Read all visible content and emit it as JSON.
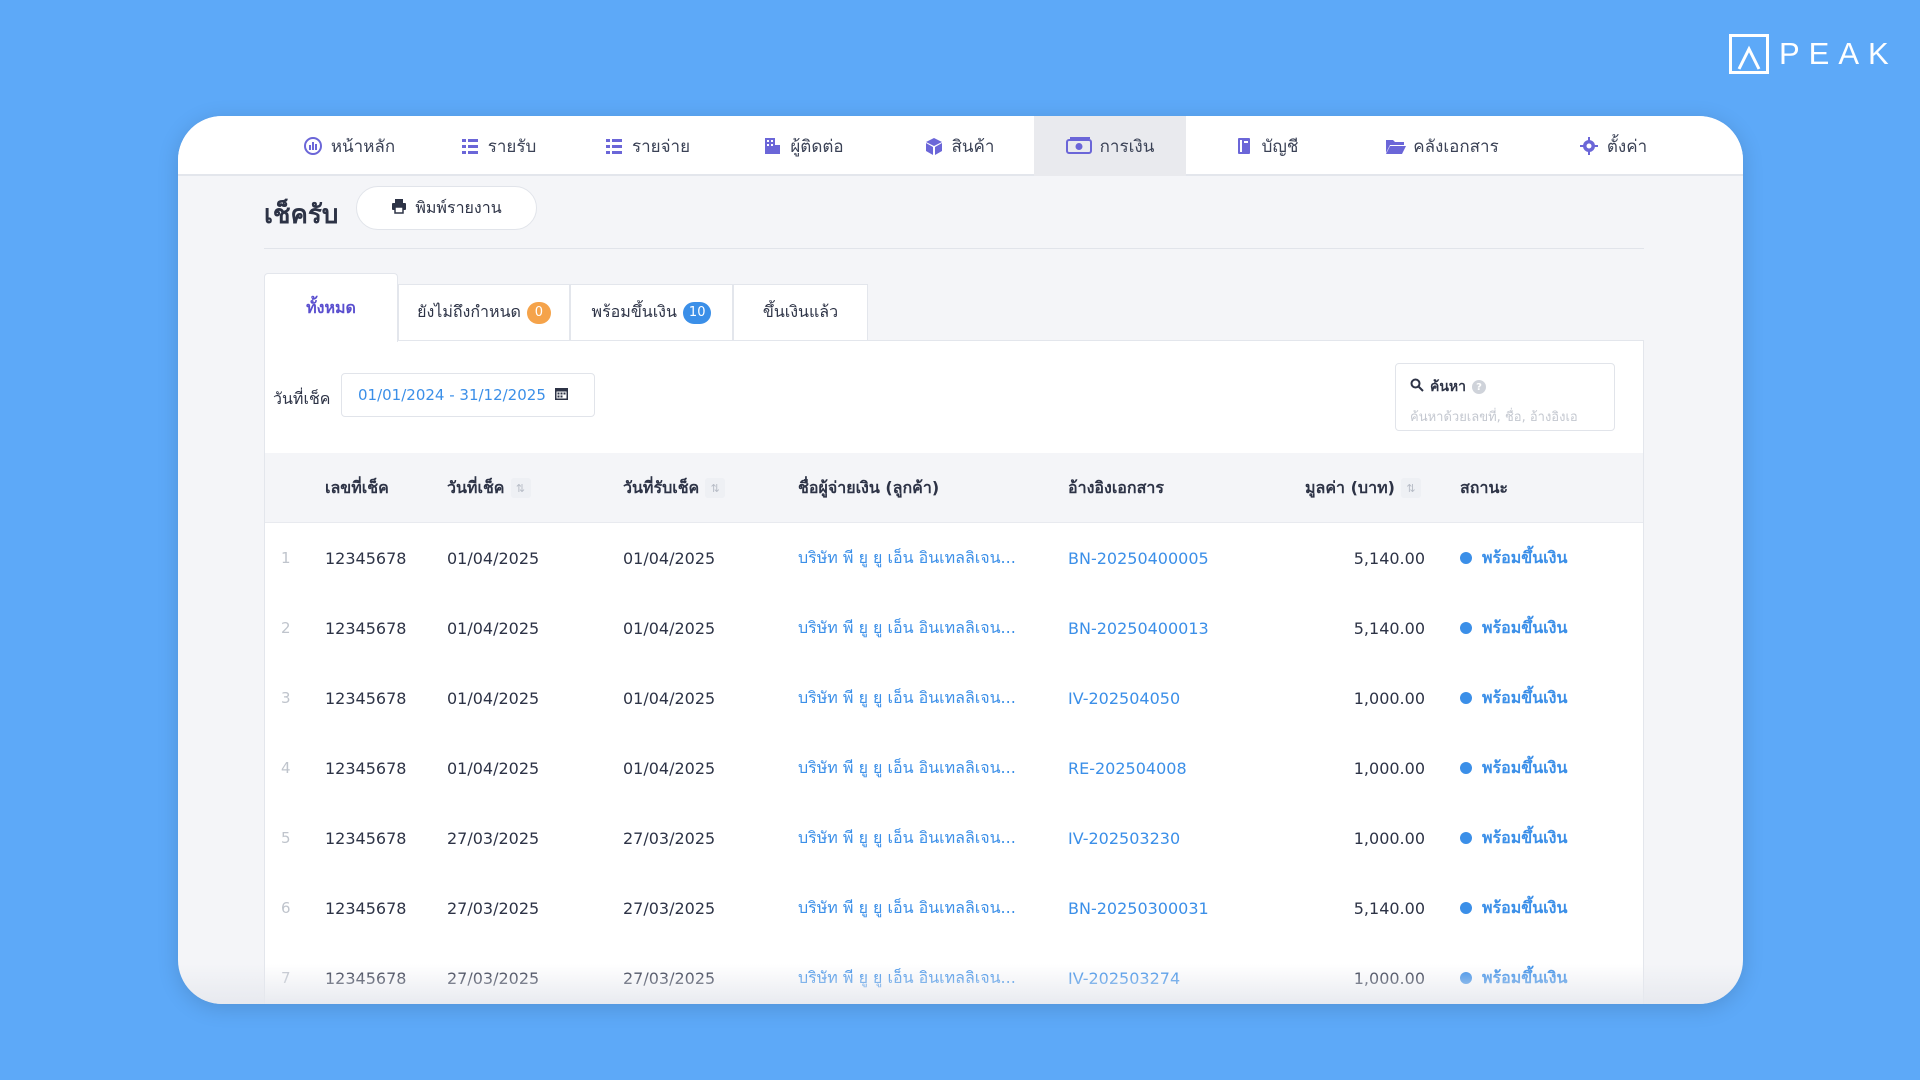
{
  "brand": {
    "name": "PEAK",
    "logo_icon": "peak-logo-icon"
  },
  "nav": {
    "items": [
      {
        "label": "หน้าหลัก",
        "icon": "dashboard-icon"
      },
      {
        "label": "รายรับ",
        "icon": "income-list-icon"
      },
      {
        "label": "รายจ่าย",
        "icon": "expense-list-icon"
      },
      {
        "label": "ผู้ติดต่อ",
        "icon": "contacts-building-icon"
      },
      {
        "label": "สินค้า",
        "icon": "product-box-icon"
      },
      {
        "label": "การเงิน",
        "icon": "money-icon",
        "active": true
      },
      {
        "label": "บัญชี",
        "icon": "ledger-book-icon"
      },
      {
        "label": "คลังเอกสาร",
        "icon": "folder-open-icon"
      },
      {
        "label": "ตั้งค่า",
        "icon": "gear-icon"
      }
    ]
  },
  "page": {
    "title": "เช็ครับ",
    "print_button": "พิมพ์รายงาน"
  },
  "tabs": [
    {
      "label": "ทั้งหมด",
      "active": true
    },
    {
      "label": "ยังไม่ถึงกำหนด",
      "badge": "0",
      "badge_color": "#f5a34a"
    },
    {
      "label": "พร้อมขึ้นเงิน",
      "badge": "10",
      "badge_color": "#3b8fe8"
    },
    {
      "label": "ขึ้นเงินแล้ว"
    }
  ],
  "filter": {
    "label": "วันที่เช็ค",
    "date_range": "01/01/2024 - 31/12/2025"
  },
  "search": {
    "label": "ค้นหา",
    "placeholder": "ค้นหาด้วยเลขที่, ชื่อ, อ้างอิงเอ"
  },
  "table": {
    "columns": [
      "เลขที่เช็ค",
      "วันที่เช็ค",
      "วันที่รับเช็ค",
      "ชื่อผู้จ่ายเงิน (ลูกค้า)",
      "อ้างอิงเอกสาร",
      "มูลค่า (บาท)",
      "สถานะ"
    ],
    "rows": [
      {
        "no": "1",
        "cheque_no": "12345678",
        "cheque_date": "01/04/2025",
        "received_date": "01/04/2025",
        "payer": "บริษัท พี ยู ยู เอ็น อินเทลลิเจน...",
        "ref": "BN-20250400005",
        "amount": "5,140.00",
        "status": "พร้อมขึ้นเงิน"
      },
      {
        "no": "2",
        "cheque_no": "12345678",
        "cheque_date": "01/04/2025",
        "received_date": "01/04/2025",
        "payer": "บริษัท พี ยู ยู เอ็น อินเทลลิเจน...",
        "ref": "BN-20250400013",
        "amount": "5,140.00",
        "status": "พร้อมขึ้นเงิน"
      },
      {
        "no": "3",
        "cheque_no": "12345678",
        "cheque_date": "01/04/2025",
        "received_date": "01/04/2025",
        "payer": "บริษัท พี ยู ยู เอ็น อินเทลลิเจน...",
        "ref": "IV-202504050",
        "amount": "1,000.00",
        "status": "พร้อมขึ้นเงิน"
      },
      {
        "no": "4",
        "cheque_no": "12345678",
        "cheque_date": "01/04/2025",
        "received_date": "01/04/2025",
        "payer": "บริษัท พี ยู ยู เอ็น อินเทลลิเจน...",
        "ref": "RE-202504008",
        "amount": "1,000.00",
        "status": "พร้อมขึ้นเงิน"
      },
      {
        "no": "5",
        "cheque_no": "12345678",
        "cheque_date": "27/03/2025",
        "received_date": "27/03/2025",
        "payer": "บริษัท พี ยู ยู เอ็น อินเทลลิเจน...",
        "ref": "IV-202503230",
        "amount": "1,000.00",
        "status": "พร้อมขึ้นเงิน"
      },
      {
        "no": "6",
        "cheque_no": "12345678",
        "cheque_date": "27/03/2025",
        "received_date": "27/03/2025",
        "payer": "บริษัท พี ยู ยู เอ็น อินเทลลิเจน...",
        "ref": "BN-20250300031",
        "amount": "5,140.00",
        "status": "พร้อมขึ้นเงิน"
      },
      {
        "no": "7",
        "cheque_no": "12345678",
        "cheque_date": "27/03/2025",
        "received_date": "27/03/2025",
        "payer": "บริษัท พี ยู ยู เอ็น อินเทลลิเจน...",
        "ref": "IV-202503274",
        "amount": "1,000.00",
        "status": "พร้อมขึ้นเงิน"
      }
    ]
  },
  "colors": {
    "background": "#5da9f8",
    "accent_blue": "#3b8fe8",
    "accent_purple": "#5a4fcf",
    "badge_orange": "#f5a34a"
  }
}
